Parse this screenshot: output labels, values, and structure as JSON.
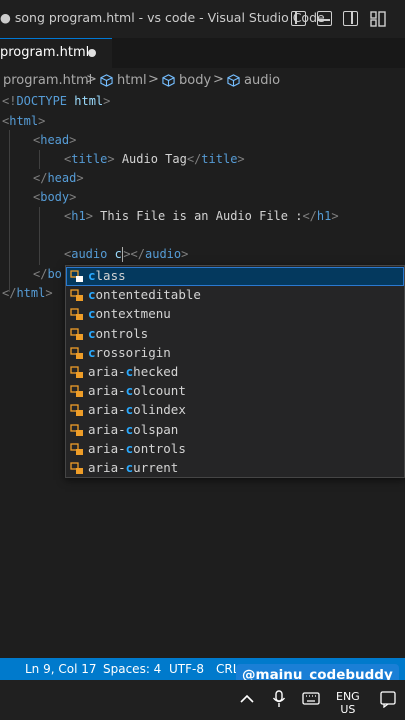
{
  "window": {
    "title": "● song program.html - vs code - Visual Studio Code"
  },
  "tab": {
    "label": "program.html",
    "dirty": true
  },
  "breadcrumbs": {
    "file": "program.html",
    "sep": ">",
    "items": [
      "html",
      "body",
      "audio"
    ]
  },
  "code": {
    "l1": {
      "a": "<!",
      "b": "DOCTYPE",
      "c": " html",
      "d": ">"
    },
    "l2": {
      "a": "<",
      "b": "html",
      "c": ">"
    },
    "l3": {
      "a": "<",
      "b": "head",
      "c": ">"
    },
    "l4": {
      "a": "<",
      "b": "title",
      "c": ">",
      "d": " Audio Tag",
      "e": "</",
      "f": "title",
      "g": ">"
    },
    "l5": {
      "a": "</",
      "b": "head",
      "c": ">"
    },
    "l6": {
      "a": "<",
      "b": "body",
      "c": ">"
    },
    "l7": {
      "a": "<",
      "b": "h1",
      "c": ">",
      "d": " This File is an Audio File :",
      "e": "</",
      "f": "h1",
      "g": ">"
    },
    "l9": {
      "a": "<",
      "b": "audio",
      "c": " c",
      "d": "></",
      "e": "audio",
      "f": ">"
    },
    "l10": {
      "a": "</",
      "b": "bo"
    },
    "l11": {
      "a": "</",
      "b": "html",
      "c": ">"
    }
  },
  "suggestions": {
    "typed": "c",
    "items": [
      {
        "pre": "",
        "match": "c",
        "post": "lass"
      },
      {
        "pre": "",
        "match": "c",
        "post": "ontenteditable"
      },
      {
        "pre": "",
        "match": "c",
        "post": "ontextmenu"
      },
      {
        "pre": "",
        "match": "c",
        "post": "ontrols"
      },
      {
        "pre": "",
        "match": "c",
        "post": "rossorigin"
      },
      {
        "pre": "aria-",
        "match": "c",
        "post": "hecked"
      },
      {
        "pre": "aria-",
        "match": "c",
        "post": "olcount"
      },
      {
        "pre": "aria-",
        "match": "c",
        "post": "olindex"
      },
      {
        "pre": "aria-",
        "match": "c",
        "post": "olspan"
      },
      {
        "pre": "aria-",
        "match": "c",
        "post": "ontrols"
      },
      {
        "pre": "aria-",
        "match": "c",
        "post": "urrent"
      }
    ]
  },
  "status": {
    "position": "Ln 9, Col 17",
    "spaces": "Spaces: 4",
    "encoding": "UTF-8",
    "eol": "CRL"
  },
  "watermark": "@mainu_codebuddy",
  "taskbar": {
    "lang1": "ENG",
    "lang2": "US",
    "icons": [
      "chevron-up-icon",
      "microphone-icon",
      "keyboard-icon",
      "volume-icon",
      "notification-icon"
    ]
  },
  "colors": {
    "accent": "#007acc",
    "tag": "#569cd6",
    "punct": "#808080",
    "match": "#2aaaff"
  }
}
